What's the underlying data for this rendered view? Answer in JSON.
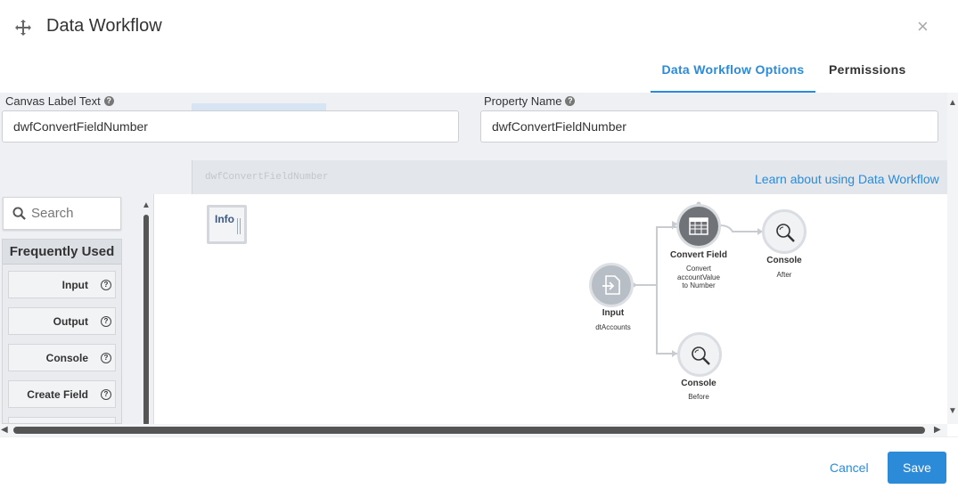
{
  "header": {
    "title": "Data Workflow",
    "icons": {
      "move": "move-icon",
      "close": "close-icon"
    }
  },
  "tabs": [
    {
      "label": "Data Workflow Options",
      "active": true
    },
    {
      "label": "Permissions",
      "active": false
    }
  ],
  "form": {
    "canvas_label": {
      "label": "Canvas Label Text",
      "value": "dwfConvertFieldNumber"
    },
    "property_name": {
      "label": "Property Name",
      "value": "dwfConvertFieldNumber"
    },
    "ghost_text": "dwfConvertFieldNumber",
    "learn_link": "Learn about using Data Workflow"
  },
  "palette": {
    "search_placeholder": "Search",
    "section_title": "Frequently Used",
    "items": [
      {
        "label": "Input"
      },
      {
        "label": "Output"
      },
      {
        "label": "Console"
      },
      {
        "label": "Create Field"
      }
    ]
  },
  "canvas": {
    "info_label": "Info",
    "nodes": [
      {
        "id": "input",
        "title": "Input",
        "subtitle": "dtAccounts",
        "icon": "input-icon"
      },
      {
        "id": "convert",
        "title": "Convert Field",
        "subtitle": [
          "Convert",
          "accountValue",
          "to Number"
        ],
        "icon": "table-icon"
      },
      {
        "id": "console-after",
        "title": "Console",
        "subtitle": "After",
        "icon": "magnifier-icon"
      },
      {
        "id": "console-before",
        "title": "Console",
        "subtitle": "Before",
        "icon": "magnifier-icon"
      }
    ]
  },
  "footer": {
    "cancel_label": "Cancel",
    "save_label": "Save"
  },
  "colors": {
    "accent": "#2b8bd8",
    "panel_bg": "#eef0f3",
    "node_dark": "#707478",
    "node_light": "#f1f2f4"
  }
}
